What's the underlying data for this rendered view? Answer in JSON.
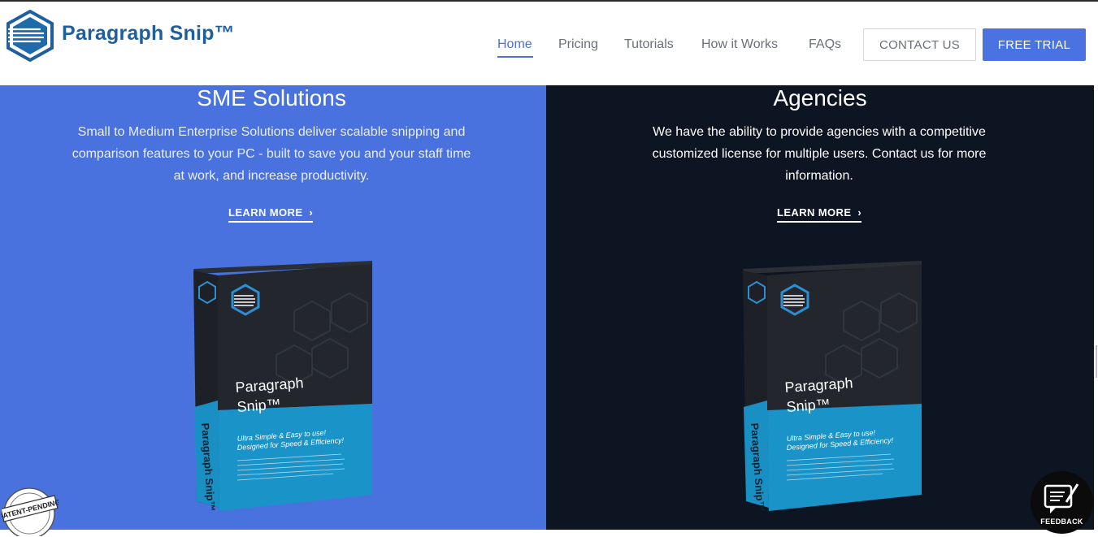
{
  "brand": {
    "name": "Paragraph Snip™",
    "color": "#1f5f9d"
  },
  "nav": {
    "items": [
      {
        "label": "Home",
        "active": true
      },
      {
        "label": "Pricing",
        "active": false
      },
      {
        "label": "Tutorials",
        "active": false
      },
      {
        "label": "How it Works",
        "active": false
      },
      {
        "label": "FAQs",
        "active": false
      }
    ],
    "contact_label": "CONTACT US",
    "trial_label": "FREE TRIAL"
  },
  "sections": {
    "sme": {
      "title": "SME Solutions",
      "description": "Small to Medium Enterprise Solutions deliver scalable snipping and comparison features to your PC - built to save you and your staff time at work, and increase productivity.",
      "cta": "LEARN MORE",
      "background": "#4a72de"
    },
    "agencies": {
      "title": "Agencies",
      "description": "We have the ability to provide agencies with a competitive customized license for multiple users. Contact us for more information.",
      "cta": "LEARN MORE",
      "background": "#0d1422"
    }
  },
  "product_box": {
    "name_line1": "Paragraph",
    "name_line2": "Snip™",
    "tagline1": "Ultra Simple & Easy to use!",
    "tagline2": "Designed for Speed & Efficiency!",
    "spine_text": "Paragraph Snip™"
  },
  "badges": {
    "patent": "PATENT-PENDING",
    "feedback": "FEEDBACK"
  },
  "colors": {
    "accent": "#4a72e0",
    "nav_text": "#6a6f78"
  },
  "icons": [
    "logo-hexagon-icon",
    "chevron-right-icon",
    "feedback-icon",
    "patent-seal-icon"
  ]
}
